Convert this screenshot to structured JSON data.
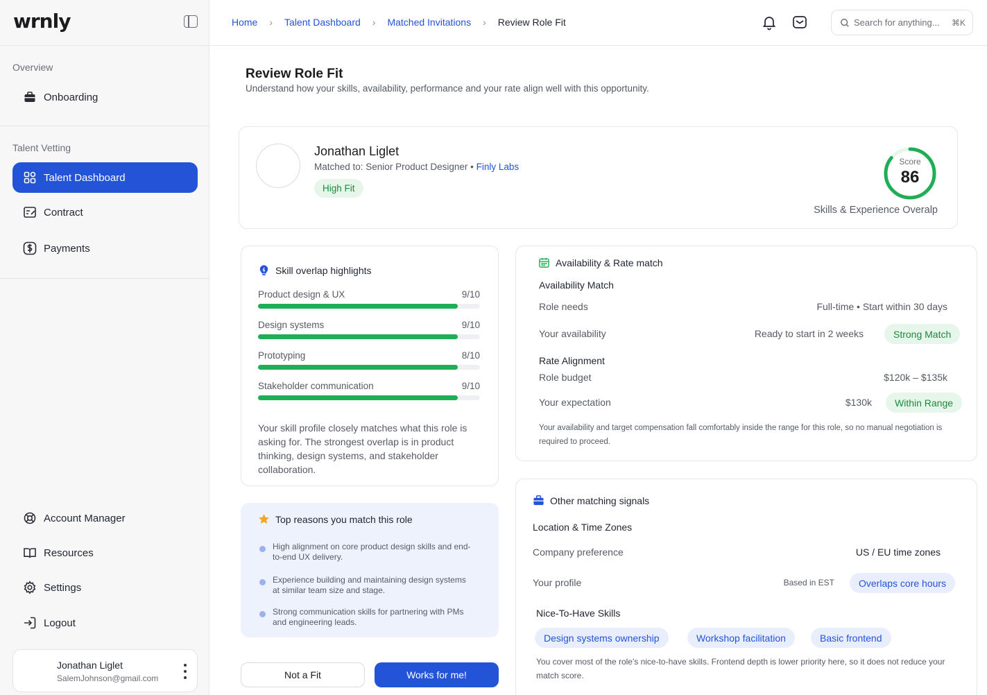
{
  "app": {
    "logo": "wrnly"
  },
  "sidebar": {
    "section_overview": "Overview",
    "onboarding": "Onboarding",
    "section_vetting": "Talent Vetting",
    "talent_dashboard": "Talent Dashboard",
    "contract": "Contract",
    "payments": "Payments",
    "account_manager": "Account Manager",
    "resources": "Resources",
    "settings": "Settings",
    "logout": "Logout",
    "user": {
      "name": "Jonathan Liglet",
      "email": "SalemJohnson@gmail.com"
    }
  },
  "header": {
    "breadcrumb": [
      "Home",
      "Talent Dashboard",
      "Matched Invitations",
      "Review Role Fit"
    ],
    "search_placeholder": "Search for anything...",
    "search_shortcut": "⌘K"
  },
  "page": {
    "title": "Review Role Fit",
    "subtitle": "Understand how your skills, availability, performance and your rate align well with this opportunity."
  },
  "candidate": {
    "name": "Jonathan Liglet",
    "matched_prefix": "Matched to: Senior Product Designer • ",
    "company": "Finly Labs",
    "fit_badge": "High Fit",
    "score_label": "Score",
    "score": "86",
    "score_pct": 86,
    "score_caption": "Skills & Experience Overalp"
  },
  "skills": {
    "title": "Skill overlap highlights",
    "items": [
      {
        "label": "Product design & UX",
        "score": "9/10",
        "value": 0.9
      },
      {
        "label": "Design systems",
        "score": "9/10",
        "value": 0.9
      },
      {
        "label": "Prototyping",
        "score": "8/10",
        "value": 0.9
      },
      {
        "label": "Stakeholder communication",
        "score": "9/10",
        "value": 0.9
      }
    ],
    "note": "Your skill profile closely matches what this role is asking for. The strongest overlap is in product thinking, design systems, and stakeholder collaboration."
  },
  "reasons": {
    "title": "Top reasons you match this role",
    "items": [
      "High alignment on core product design skills and end-to-end UX delivery.",
      "Experience building and maintaining design systems at similar team size and stage.",
      "Strong communication skills for partnering with PMs and engineering leads."
    ]
  },
  "availability": {
    "title": "Availability & Rate match",
    "availability_heading": "Availability Match",
    "role_needs_label": "Role needs",
    "role_needs_value": "Full-time • Start within 30 days",
    "your_availability_label": "Your availability",
    "your_availability_value": "Ready to start in 2 weeks",
    "availability_badge": "Strong Match",
    "rate_heading": "Rate Alignment",
    "role_budget_label": "Role budget",
    "role_budget_value": "$120k – $135k",
    "your_expectation_label": "Your expectation",
    "your_expectation_value": "$130k",
    "rate_badge": "Within Range",
    "note": "Your availability and target compensation fall comfortably inside the range for this role, so no manual negotiation is required to proceed."
  },
  "signals": {
    "title": "Other matching signals",
    "location_heading": "Location & Time Zones",
    "company_pref_label": "Company preference",
    "company_pref_value": "US / EU time zones",
    "your_profile_label": "Your profile",
    "your_profile_value": "Based in EST",
    "profile_badge": "Overlaps core hours",
    "nice_heading": "Nice-To-Have Skills",
    "nice_skills": [
      "Design systems ownership",
      "Workshop facilitation",
      "Basic frontend"
    ],
    "note": "You cover most of the role's nice-to-have skills. Frontend depth is lower priority here, so it does not reduce your match score."
  },
  "actions": {
    "not_fit": "Not a Fit",
    "works": "Works for me!"
  },
  "colors": {
    "accent": "#2353d6",
    "success": "#1fae55",
    "success_bg": "#e6f6ea",
    "info_bg": "#e8eefc",
    "reasons_bg": "#eef2fd"
  }
}
